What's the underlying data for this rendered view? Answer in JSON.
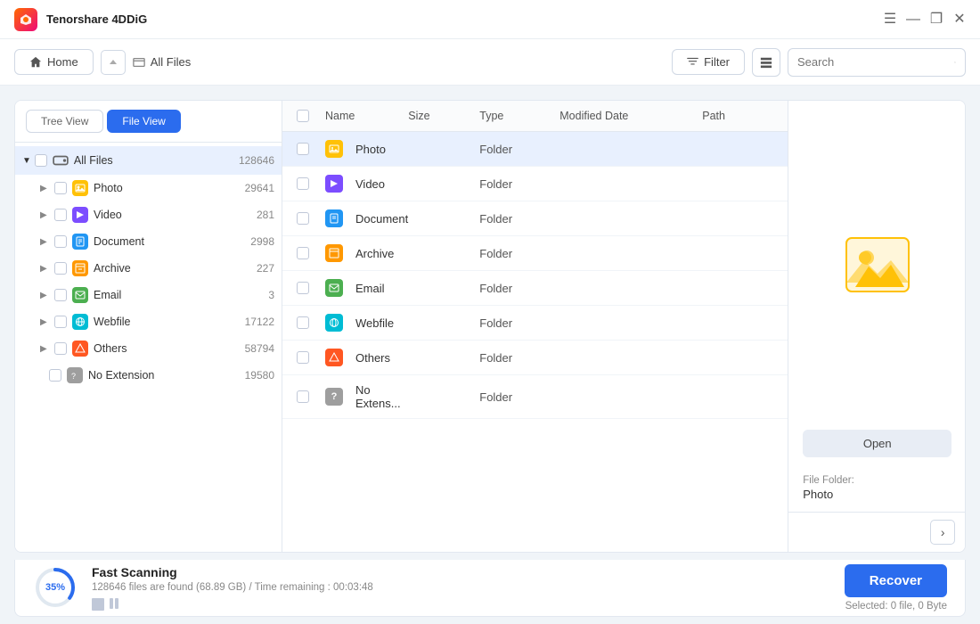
{
  "app": {
    "name": "Tenorshare 4DDiG",
    "logo_color": "#ff6a00"
  },
  "titlebar": {
    "title": "Tenorshare 4DDiG",
    "minimize": "—",
    "restore": "❐",
    "close": "✕",
    "hamburger": "☰"
  },
  "navbar": {
    "home_label": "Home",
    "all_files_label": "All Files",
    "filter_label": "Filter",
    "search_placeholder": "Search"
  },
  "sidebar": {
    "tree_view_label": "Tree View",
    "file_view_label": "File View",
    "root": {
      "label": "All Files",
      "count": "128646"
    },
    "items": [
      {
        "label": "Photo",
        "count": "29641",
        "icon": "photo"
      },
      {
        "label": "Video",
        "count": "281",
        "icon": "video"
      },
      {
        "label": "Document",
        "count": "2998",
        "icon": "document"
      },
      {
        "label": "Archive",
        "count": "227",
        "icon": "archive"
      },
      {
        "label": "Email",
        "count": "3",
        "icon": "email"
      },
      {
        "label": "Webfile",
        "count": "17122",
        "icon": "webfile"
      },
      {
        "label": "Others",
        "count": "58794",
        "icon": "others"
      },
      {
        "label": "No Extension",
        "count": "19580",
        "icon": "noext"
      }
    ]
  },
  "filelist": {
    "headers": {
      "name": "Name",
      "size": "Size",
      "type": "Type",
      "modified_date": "Modified Date",
      "path": "Path"
    },
    "rows": [
      {
        "name": "Photo",
        "size": "",
        "type": "Folder",
        "date": "",
        "path": "",
        "icon": "photo",
        "selected": true
      },
      {
        "name": "Video",
        "size": "",
        "type": "Folder",
        "date": "",
        "path": "",
        "icon": "video",
        "selected": false
      },
      {
        "name": "Document",
        "size": "",
        "type": "Folder",
        "date": "",
        "path": "",
        "icon": "document",
        "selected": false
      },
      {
        "name": "Archive",
        "size": "",
        "type": "Folder",
        "date": "",
        "path": "",
        "icon": "archive",
        "selected": false
      },
      {
        "name": "Email",
        "size": "",
        "type": "Folder",
        "date": "",
        "path": "",
        "icon": "email",
        "selected": false
      },
      {
        "name": "Webfile",
        "size": "",
        "type": "Folder",
        "date": "",
        "path": "",
        "icon": "webfile",
        "selected": false
      },
      {
        "name": "Others",
        "size": "",
        "type": "Folder",
        "date": "",
        "path": "",
        "icon": "others",
        "selected": false
      },
      {
        "name": "No Extens...",
        "size": "",
        "type": "Folder",
        "date": "",
        "path": "",
        "icon": "noext",
        "selected": false
      }
    ]
  },
  "preview": {
    "open_label": "Open",
    "file_folder_label": "File Folder:",
    "file_folder_value": "Photo"
  },
  "bottombar": {
    "progress_percent": "35%",
    "progress_value": 35,
    "scan_title": "Fast Scanning",
    "scan_detail": "128646 files are found (68.89 GB) /  Time remaining : 00:03:48",
    "recover_label": "Recover",
    "selected_info": "Selected: 0 file, 0 Byte"
  }
}
